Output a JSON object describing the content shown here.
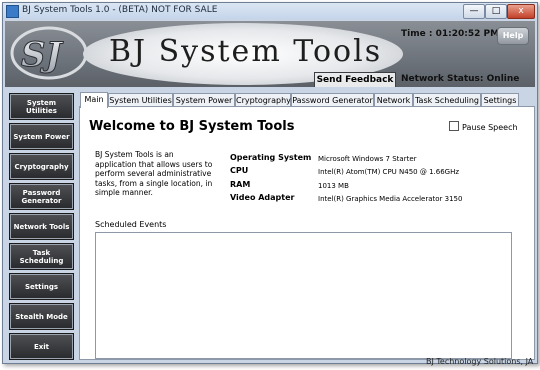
{
  "window": {
    "title": "BJ System Tools 1.0 - (BETA) NOT FOR SALE",
    "minimize_label": "—",
    "maximize_label": "□",
    "close_label": "x"
  },
  "header": {
    "logo_mark": "SJ",
    "title": "BJ System Tools",
    "time_text": "Time : 01:20:52 PM",
    "help_label": "Help",
    "feedback_label": "Send Feedback",
    "network_status": "Network Status: Online"
  },
  "sidebar": {
    "items": [
      {
        "label": "System Utilities"
      },
      {
        "label": "System Power"
      },
      {
        "label": "Cryptography"
      },
      {
        "label": "Password Generator"
      },
      {
        "label": "Network Tools"
      },
      {
        "label": "Task Scheduling"
      },
      {
        "label": "Settings"
      },
      {
        "label": "Stealth Mode"
      },
      {
        "label": "Exit"
      }
    ]
  },
  "tabs": [
    "Main",
    "System Utilities",
    "System Power",
    "Cryptography",
    "Password Generator",
    "Network",
    "Task Scheduling",
    "Settings"
  ],
  "main": {
    "welcome": "Welcome to BJ System Tools",
    "pause_label": "Pause Speech",
    "description": "BJ System Tools is an application that allows users to perform several administrative tasks, from a single location, in simple manner.",
    "info": [
      {
        "label": "Operating System",
        "value": "Microsoft Windows 7 Starter"
      },
      {
        "label": "CPU",
        "value": "Intel(R) Atom(TM) CPU N450   @ 1.66GHz"
      },
      {
        "label": "RAM",
        "value": "1013 MB"
      },
      {
        "label": "Video Adapter",
        "value": "Intel(R) Graphics Media Accelerator 3150"
      }
    ],
    "scheduled_label": "Scheduled Events"
  },
  "footer": "BJ Technology Solutions, JA"
}
